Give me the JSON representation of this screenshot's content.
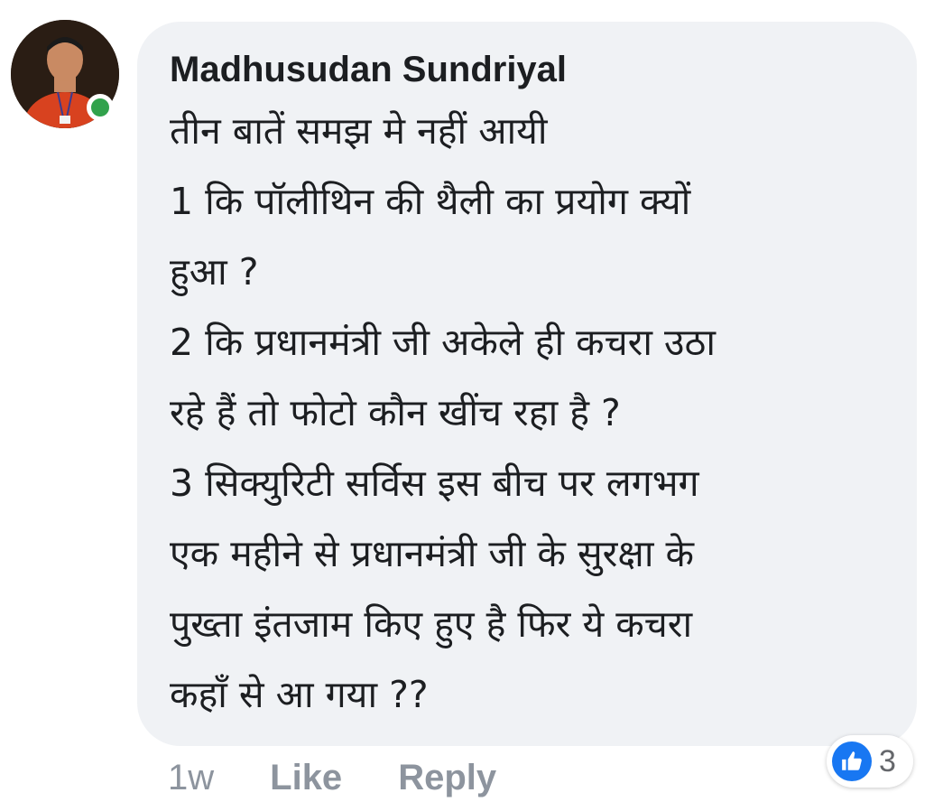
{
  "comment": {
    "author": "Madhusudan Sundriyal",
    "lines": [
      "तीन बातें समझ मे नहीं आयी",
      "1 कि पॉलीथिन की थैली का प्रयोग क्यों",
      "हुआ ?",
      "2 कि प्रधानमंत्री जी अकेले ही कचरा उठा",
      "रहे हैं तो फोटो कौन खींच रहा है ?",
      "3 सिक्युरिटी सर्विस इस बीच पर लगभग",
      "एक महीने से प्रधानमंत्री जी के सुरक्षा के",
      "पुख्ता इंतजाम किए हुए है फिर ये कचरा",
      "कहाँ से आ गया ??"
    ],
    "online": true
  },
  "actions": {
    "timestamp": "1w",
    "like_label": "Like",
    "reply_label": "Reply"
  },
  "reactions": {
    "icon": "like-icon",
    "count": "3"
  },
  "colors": {
    "bubble_bg": "#f0f2f5",
    "text": "#1c1e21",
    "muted": "#8d949e",
    "online": "#31a24c",
    "like_blue": "#1877f2"
  }
}
